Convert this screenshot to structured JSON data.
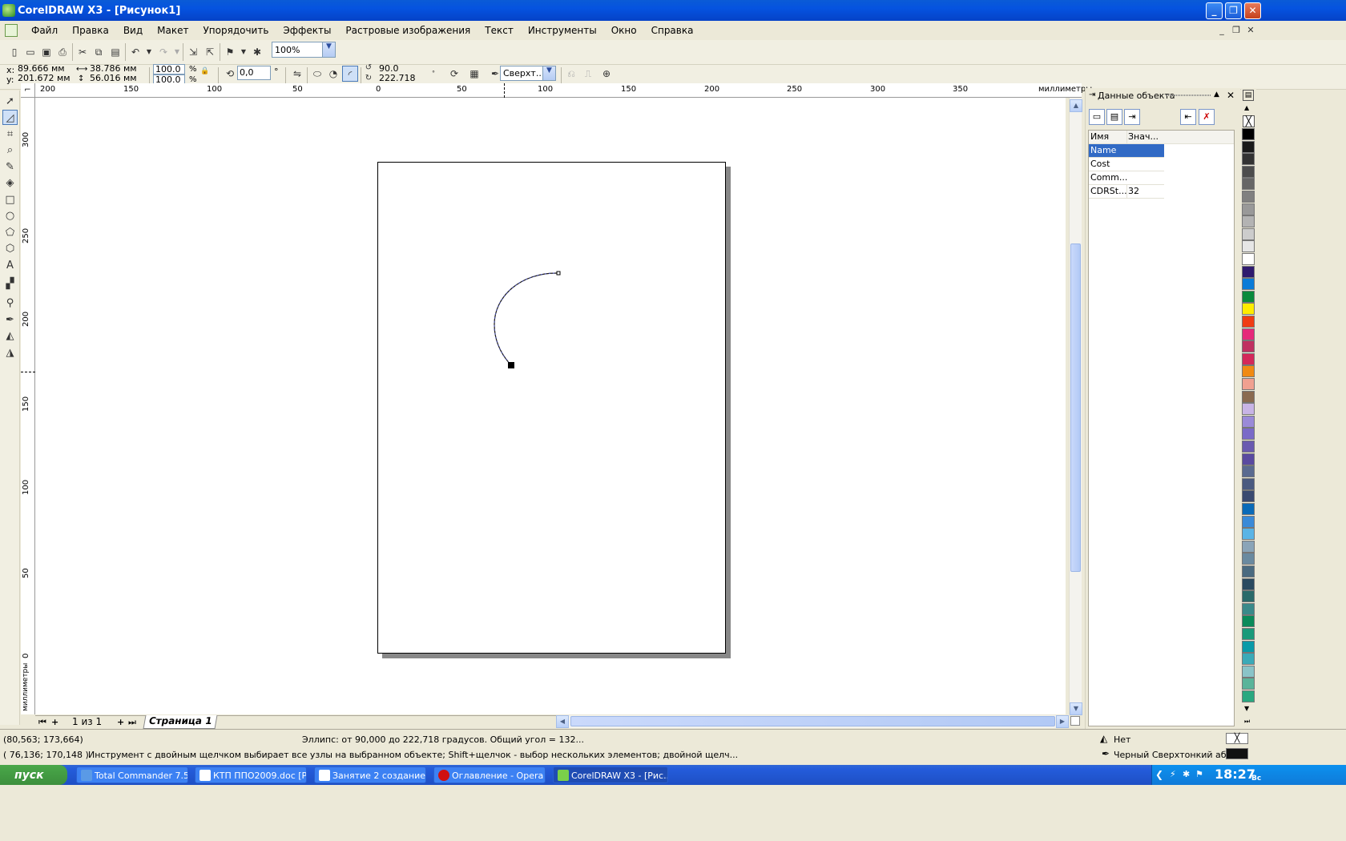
{
  "window": {
    "title": "CorelDRAW X3 - [Рисунок1]",
    "min": "_",
    "restore": "❐",
    "close": "✕"
  },
  "menu": [
    "Файл",
    "Правка",
    "Вид",
    "Макет",
    "Упорядочить",
    "Эффекты",
    "Растровые изображения",
    "Текст",
    "Инструменты",
    "Окно",
    "Справка"
  ],
  "toolbar": {
    "zoom": "100%"
  },
  "props": {
    "x_label": "x:",
    "x_val": "89.666 мм",
    "y_label": "y:",
    "y_val": "201.672 мм",
    "w_val": "38.786 мм",
    "h_val": "56.016 мм",
    "sx": "100.0",
    "sy": "100.0",
    "pct1": "%",
    "pct2": "%",
    "rotation": "0,0",
    "deg": "°",
    "start_angle": "90.0",
    "end_angle": "222.718",
    "outline": "Сверхт..."
  },
  "ruler": {
    "unit": "миллиметры",
    "h_ticks": [
      "200",
      "150",
      "100",
      "50",
      "0",
      "50",
      "100",
      "150",
      "200",
      "250",
      "300",
      "350"
    ],
    "v_ticks": [
      "300",
      "250",
      "200",
      "150",
      "100",
      "50",
      "0"
    ],
    "v_unit": "миллиметры"
  },
  "pagenav": {
    "count": "1 из 1",
    "tab": "Страница 1"
  },
  "docker": {
    "title": "Данные объекта",
    "col_name": "Имя",
    "col_value": "Знач...",
    "rows": [
      {
        "name": "Name",
        "value": ""
      },
      {
        "name": "Cost",
        "value": ""
      },
      {
        "name": "Comm...",
        "value": ""
      },
      {
        "name": "CDRSt...",
        "value": "32"
      }
    ]
  },
  "status": {
    "coords1": "(80,563; 173,664)",
    "info": "Эллипс: от 90,000 до 222,718 градусов.  Общий угол = 132...",
    "coords2": "( 76,136; 170,148 )",
    "hint": "Инструмент с двойным щелчком выбирает все узлы на выбранном объекте; Shift+щелчок - выбор нескольких элементов; двойной щелч...",
    "fill": "Нет",
    "outline": "Черный  Сверхтонкий абрис"
  },
  "taskbar": {
    "start": "пуск",
    "tasks": [
      "Total Commander 7.5...",
      "КТП ППО2009.doc [Р...",
      "Занятие 2 создание ...",
      "Оглавление - Opera",
      "CorelDRAW X3 - [Рис..."
    ],
    "clock": "18:27",
    "day": "Вс"
  },
  "palette": [
    "#000000",
    "#1a1a1a",
    "#333333",
    "#4d4d4d",
    "#666666",
    "#808080",
    "#999999",
    "#b3b3b3",
    "#cccccc",
    "#e6e6e6",
    "#ffffff",
    "#2e1a6e",
    "#0a7bd8",
    "#0a8a3c",
    "#ffec00",
    "#f03c14",
    "#e6287a",
    "#c03060",
    "#d4285a",
    "#f08a14",
    "#f0a090",
    "#8a6a50",
    "#c8b4e6",
    "#9a8ad8",
    "#7a6ac8",
    "#6a5ab0",
    "#5a4aa0",
    "#5a6a90",
    "#4a5a80",
    "#3a4a70",
    "#0a6ab8",
    "#3a8ad8",
    "#5ab4e6",
    "#8aa4b8",
    "#6a8aa0",
    "#4a6a80",
    "#2a4a60",
    "#2a6a6a",
    "#3a8a8a",
    "#0a8a5a",
    "#1a9a7a",
    "#0a9aa8",
    "#3aaab8",
    "#8ac4c8",
    "#5ab49a",
    "#2aa880"
  ]
}
